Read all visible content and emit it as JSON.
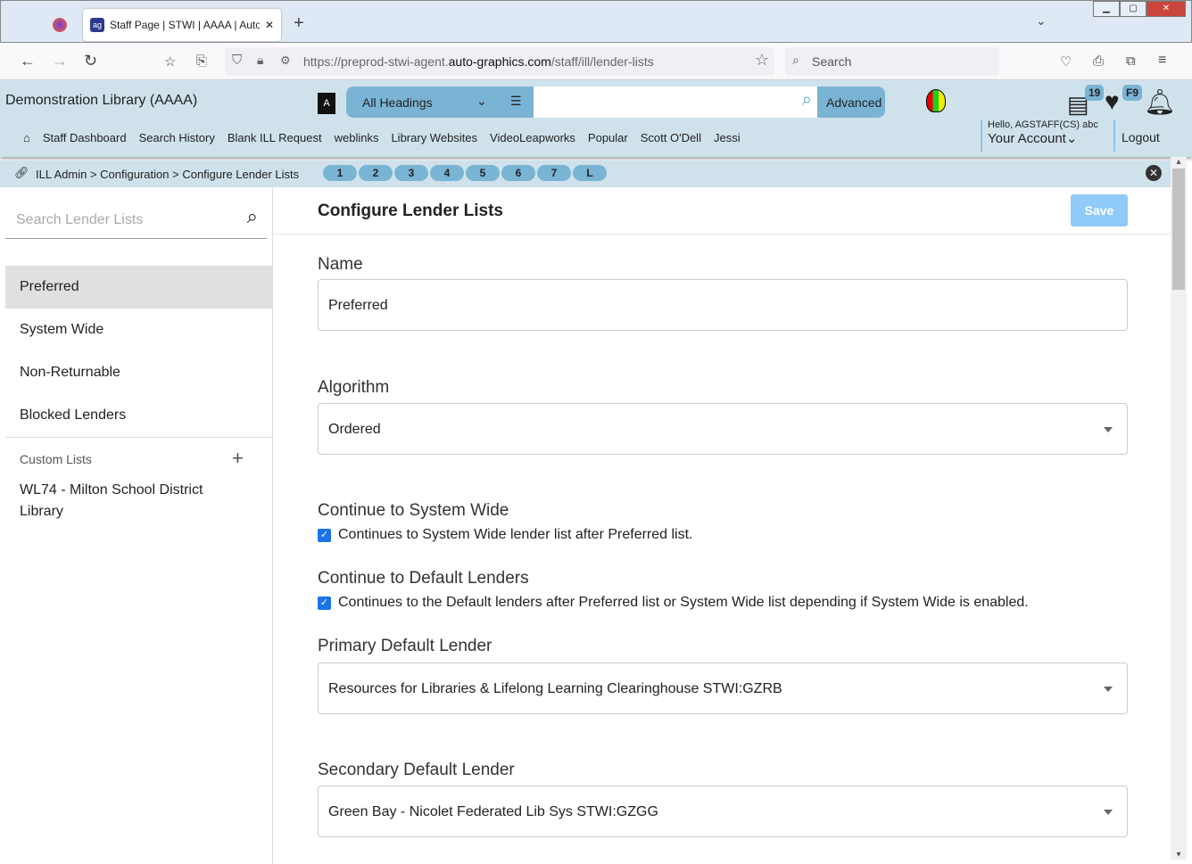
{
  "browser": {
    "tab_title": "Staff Page | STWI | AAAA | Auto-",
    "url_prefix": "https://preprod-stwi-agent.",
    "url_domain": "auto-graphics.com",
    "url_path": "/staff/ill/lender-lists",
    "search_placeholder": "Search"
  },
  "header": {
    "library_name": "Demonstration Library (AAAA)",
    "search_scope": "All Headings",
    "search_value": "",
    "advanced_label": "Advanced",
    "badge_list": "19",
    "badge_fav": "F9",
    "greeting": "Hello, AGSTAFF(CS) abc",
    "account_label": "Your Account",
    "logout_label": "Logout",
    "nav_links": [
      "Staff Dashboard",
      "Search History",
      "Blank ILL Request",
      "weblinks",
      "Library Websites",
      "VideoLeapworks",
      "Popular",
      "Scott O'Dell",
      "Jessi"
    ]
  },
  "breadcrumb": {
    "items": [
      "ILL Admin",
      "Configuration",
      "Configure Lender Lists"
    ],
    "pills": [
      "1",
      "2",
      "3",
      "4",
      "5",
      "6",
      "7",
      "L"
    ]
  },
  "sidebar": {
    "search_placeholder": "Search Lender Lists",
    "items": [
      "Preferred",
      "System Wide",
      "Non-Returnable",
      "Blocked Lenders"
    ],
    "selected": "Preferred",
    "custom_heading": "Custom Lists",
    "custom_items": [
      "WL74 - Milton School District Library"
    ]
  },
  "main": {
    "title": "Configure Lender Lists",
    "save_label": "Save",
    "name_label": "Name",
    "name_value": "Preferred",
    "algorithm_label": "Algorithm",
    "algorithm_value": "Ordered",
    "continue_sw_label": "Continue to System Wide",
    "continue_sw_text": "Continues to System Wide lender list after Preferred list.",
    "continue_sw_checked": true,
    "continue_def_label": "Continue to Default Lenders",
    "continue_def_text": "Continues to the Default lenders after Preferred list or System Wide list depending if System Wide is enabled.",
    "continue_def_checked": true,
    "primary_label": "Primary Default Lender",
    "primary_value": "Resources for Libraries & Lifelong Learning Clearinghouse STWI:GZRB",
    "secondary_label": "Secondary Default Lender",
    "secondary_value": "Green Bay - Nicolet Federated Lib Sys STWI:GZGG"
  },
  "colors": {
    "header_bg": "#cfe2ec",
    "accent": "#7ab4d4",
    "save_disabled": "#90caf9",
    "checkbox": "#1a73e8"
  }
}
